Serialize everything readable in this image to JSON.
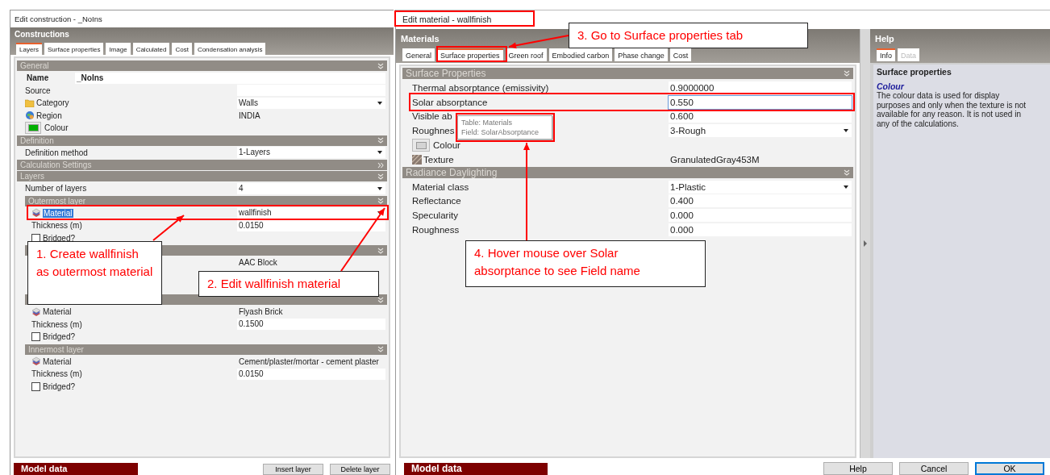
{
  "construction": {
    "title": "Edit construction - _NoIns",
    "header": "Constructions",
    "tabs": [
      {
        "label": "Layers",
        "selected": true
      },
      {
        "label": "Surface properties",
        "selected": false
      },
      {
        "label": "Image",
        "selected": false
      },
      {
        "label": "Calculated",
        "selected": false
      },
      {
        "label": "Cost",
        "selected": false
      },
      {
        "label": "Condensation analysis",
        "selected": false
      }
    ],
    "sections": [
      {
        "title": "General",
        "expanded": true,
        "rows": [
          {
            "kind": "name",
            "label": "Name",
            "value": "_NoIns"
          },
          {
            "kind": "plain",
            "label": "Source",
            "value": {
              "kind": "field"
            }
          },
          {
            "kind": "folder",
            "label": "Category",
            "value": {
              "kind": "dropdown",
              "text": "Walls"
            }
          },
          {
            "kind": "region",
            "label": "Region",
            "value": {
              "kind": "text",
              "text": "INDIA"
            }
          },
          {
            "kind": "colour",
            "label": "Colour",
            "color": "#00b000"
          }
        ]
      },
      {
        "title": "Definition",
        "expanded": true,
        "rows": [
          {
            "kind": "plain",
            "label": "Definition method",
            "value": {
              "kind": "dropdown",
              "text": "1-Layers"
            }
          }
        ]
      },
      {
        "title": "Calculation Settings",
        "expanded": false
      },
      {
        "title": "Layers",
        "expanded": true,
        "rows": [
          {
            "kind": "plain",
            "label": "Number of layers",
            "value": {
              "kind": "dropdown",
              "text": "4"
            }
          }
        ],
        "groups": [
          {
            "title": "Outermost layer",
            "rows": [
              {
                "kind": "material",
                "label": "Material",
                "selected": true,
                "value": {
                  "kind": "dropdown",
                  "text": "wallfinish"
                }
              },
              {
                "kind": "plain",
                "label": "Thickness (m)",
                "value": {
                  "kind": "field",
                  "text": "0.0150"
                }
              },
              {
                "kind": "checkbox",
                "label": "Bridged?",
                "checked": false
              }
            ]
          },
          {
            "rows": [
              {
                "kind": "plain",
                "value": {
                  "kind": "text",
                  "text": "AAC Block"
                }
              }
            ]
          },
          {
            "rows": [
              {
                "kind": "material",
                "label": "Material",
                "selected": false,
                "value": {
                  "kind": "text",
                  "text": "Flyash Brick"
                }
              },
              {
                "kind": "plain",
                "label": "Thickness (m)",
                "value": {
                  "kind": "field",
                  "text": "0.1500"
                }
              },
              {
                "kind": "checkbox",
                "label": "Bridged?",
                "checked": false
              }
            ]
          },
          {
            "title": "Innermost layer",
            "rows": [
              {
                "kind": "material",
                "label": "Material",
                "selected": false,
                "value": {
                  "kind": "text",
                  "text": "Cement/plaster/mortar - cement plaster"
                }
              },
              {
                "kind": "plain",
                "label": "Thickness (m)",
                "value": {
                  "kind": "field",
                  "text": "0.0150"
                }
              },
              {
                "kind": "checkbox",
                "label": "Bridged?",
                "checked": false
              }
            ]
          }
        ]
      }
    ],
    "footer": {
      "label": "Model data",
      "buttons": [
        {
          "label": "Insert layer",
          "default": false
        },
        {
          "label": "Delete layer",
          "default": false
        }
      ]
    }
  },
  "material": {
    "title": "Edit material - wallfinish",
    "header": "Materials",
    "tabs": [
      {
        "label": "General",
        "selected": false
      },
      {
        "label": "Surface properties",
        "selected": true
      },
      {
        "label": "Green roof",
        "selected": false
      },
      {
        "label": "Embodied carbon",
        "selected": false
      },
      {
        "label": "Phase change",
        "selected": false
      },
      {
        "label": "Cost",
        "selected": false
      }
    ],
    "sections": [
      {
        "title": "Surface Properties",
        "expanded": true,
        "rows": [
          {
            "kind": "plain",
            "label": "Thermal absorptance (emissivity)",
            "value": {
              "kind": "field",
              "text": "0.9000000"
            }
          },
          {
            "kind": "plain",
            "label": "Solar absorptance",
            "value": {
              "kind": "active-field",
              "text": "0.550"
            }
          },
          {
            "kind": "plain",
            "label": "Visible ab",
            "value": {
              "kind": "field",
              "text": "0.600"
            }
          },
          {
            "kind": "plain",
            "label": "Roughnes",
            "value": {
              "kind": "dropdown",
              "text": "3-Rough"
            }
          },
          {
            "kind": "colour",
            "label": "Colour",
            "color": "#d4d4d4"
          },
          {
            "kind": "texture",
            "label": "Texture",
            "value": {
              "kind": "text",
              "text": "GranulatedGray453M"
            }
          }
        ]
      },
      {
        "title": "Radiance Daylighting",
        "expanded": true,
        "rows": [
          {
            "kind": "plain",
            "label": "Material class",
            "value": {
              "kind": "dropdown",
              "text": "1-Plastic"
            }
          },
          {
            "kind": "plain",
            "label": "Reflectance",
            "value": {
              "kind": "field",
              "text": "0.400"
            }
          },
          {
            "kind": "plain",
            "label": "Specularity",
            "value": {
              "kind": "field",
              "text": "0.000"
            }
          },
          {
            "kind": "plain",
            "label": "Roughness",
            "value": {
              "kind": "field",
              "text": "0.000"
            }
          }
        ]
      }
    ],
    "footer": {
      "label": "Model data",
      "buttons": [
        {
          "label": "Help",
          "default": false
        },
        {
          "label": "Cancel",
          "default": false
        },
        {
          "label": "OK",
          "default": true
        }
      ]
    }
  },
  "help": {
    "header": "Help",
    "tabs": [
      {
        "label": "Info",
        "selected": true
      },
      {
        "label": "Data",
        "selected": false
      }
    ],
    "heading": "Surface properties",
    "topic": "Colour",
    "text": "The colour data is used for display purposes and only when the texture is not available for any reason. It is not used in any of the calculations."
  },
  "tooltip": {
    "lines": [
      "Table: Materials",
      "Field: SolarAbsorptance"
    ]
  },
  "callouts": [
    {
      "text": "1. Create wallfinish as outermost material"
    },
    {
      "text": "2. Edit wallfinish material"
    },
    {
      "text": "3. Go to Surface properties tab"
    },
    {
      "text": "4. Hover mouse over Solar absorptance to see Field name"
    }
  ]
}
